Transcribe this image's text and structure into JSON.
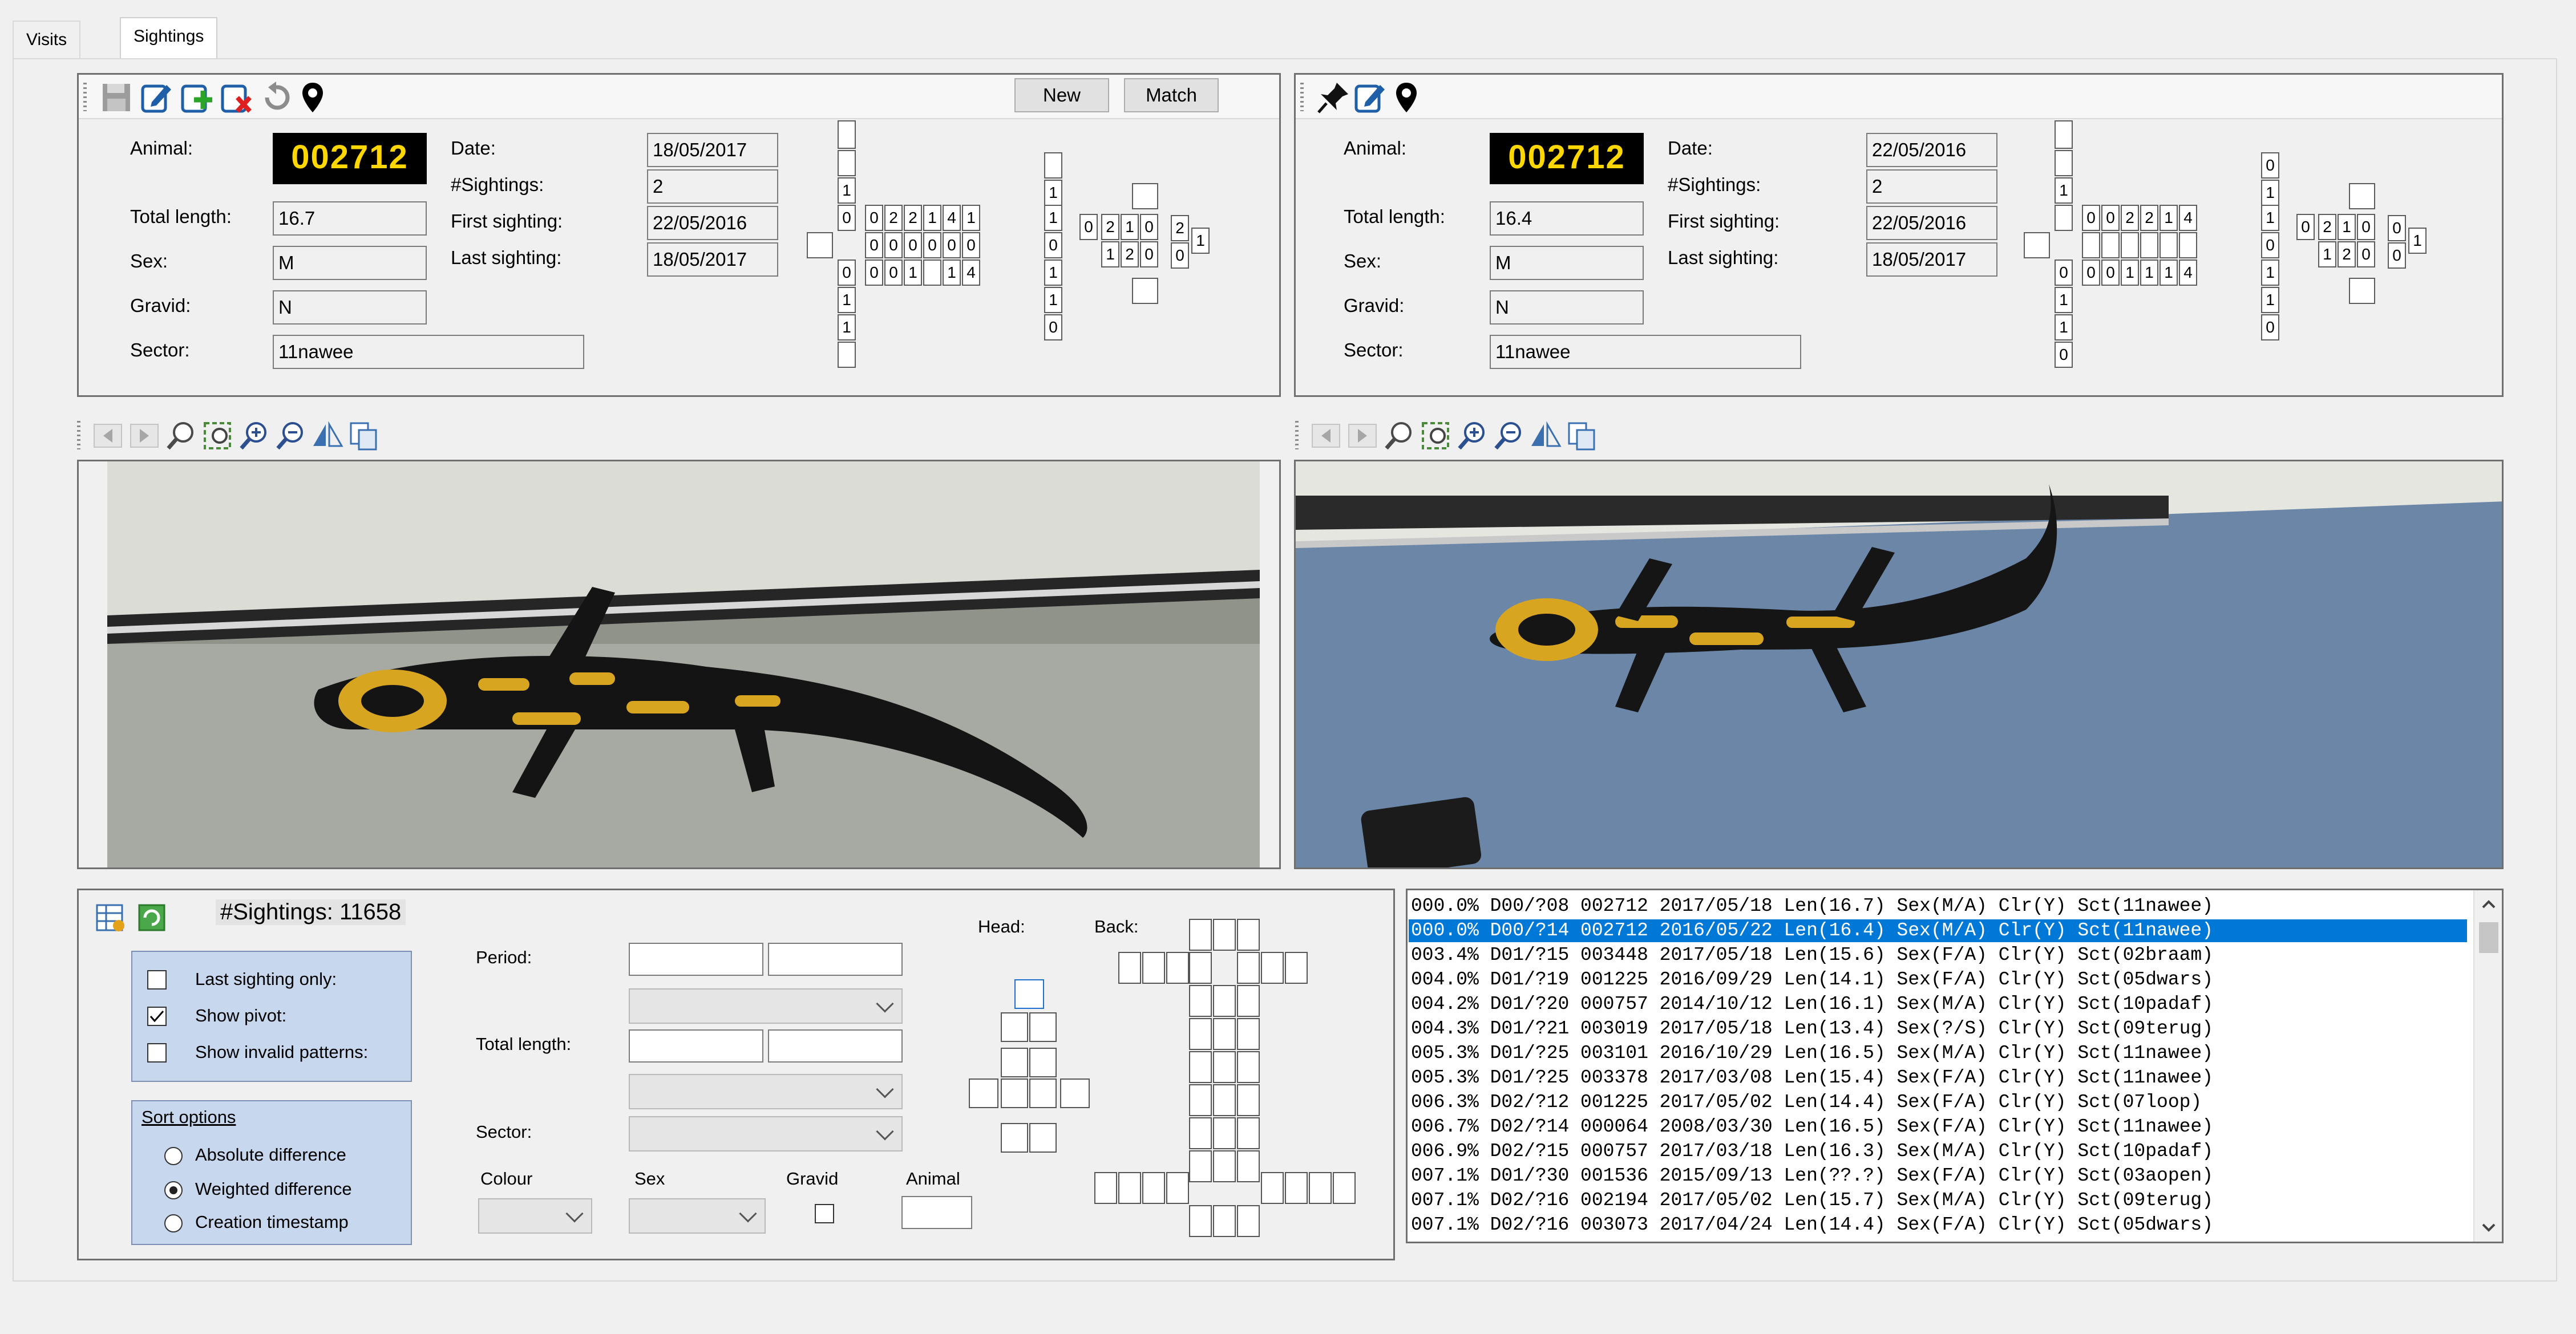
{
  "tabs": [
    {
      "label": "Visits"
    },
    {
      "label": "Sightings"
    }
  ],
  "buttons": {
    "new": "New",
    "match": "Match"
  },
  "labels": {
    "animal": "Animal:",
    "total_length": "Total length:",
    "sex": "Sex:",
    "gravid": "Gravid:",
    "sector": "Sector:",
    "date": "Date:",
    "sightings": "#Sightings:",
    "first_sighting": "First sighting:",
    "last_sighting": "Last sighting:"
  },
  "left_record": {
    "animal_id": "002712",
    "total_length": "16.7",
    "sex": "M",
    "gravid": "N",
    "sector": "11nawee",
    "date": "18/05/2017",
    "sightings": "2",
    "first_sighting": "22/05/2016",
    "last_sighting": "18/05/2017"
  },
  "right_record": {
    "animal_id": "002712",
    "total_length": "16.4",
    "sex": "M",
    "gravid": "N",
    "sector": "11nawee",
    "date": "22/05/2016",
    "sightings": "2",
    "first_sighting": "22/05/2016",
    "last_sighting": "18/05/2017"
  },
  "search": {
    "count_label": "#Sightings: 11658",
    "last_sighting_only": "Last sighting only:",
    "show_pivot": "Show pivot:",
    "show_invalid": "Show invalid patterns:",
    "sort_title": "Sort options",
    "sort_absolute": "Absolute difference",
    "sort_weighted": "Weighted difference",
    "sort_creation": "Creation timestamp",
    "period": "Period:",
    "total_length": "Total length:",
    "sector": "Sector:",
    "colour": "Colour",
    "sex": "Sex",
    "gravid": "Gravid",
    "animal": "Animal",
    "head": "Head:",
    "back": "Back:"
  },
  "matches": [
    "000.0% D00/?08 002712 2017/05/18 Len(16.7) Sex(M/A) Clr(Y) Sct(11nawee)",
    "000.0% D00/?14 002712 2016/05/22 Len(16.4) Sex(M/A) Clr(Y) Sct(11nawee)",
    "003.4% D01/?15 003448 2017/05/18 Len(15.6) Sex(F/A) Clr(Y) Sct(02braam)",
    "004.0% D01/?19 001225 2016/09/29 Len(14.1) Sex(F/A) Clr(Y) Sct(05dwars)",
    "004.2% D01/?20 000757 2014/10/12 Len(16.1) Sex(M/A) Clr(Y) Sct(10padaf)",
    "004.3% D01/?21 003019 2017/05/18 Len(13.4) Sex(?/S) Clr(Y) Sct(09terug)",
    "005.3% D01/?25 003101 2016/10/29 Len(16.5) Sex(M/A) Clr(Y) Sct(11nawee)",
    "005.3% D01/?25 003378 2017/03/08 Len(15.4) Sex(F/A) Clr(Y) Sct(11nawee)",
    "006.3% D02/?12 001225 2017/05/02 Len(14.4) Sex(F/A) Clr(Y) Sct(07loop)",
    "006.7% D02/?14 000064 2008/03/30 Len(16.5) Sex(F/A) Clr(Y) Sct(11nawee)",
    "006.9% D02/?15 000757 2017/03/18 Len(16.3) Sex(M/A) Clr(Y) Sct(10padaf)",
    "007.1% D01/?30 001536 2015/09/13 Len(??.?) Sex(F/A) Clr(Y) Sct(03aopen)",
    "007.1% D02/?16 002194 2017/05/02 Len(15.7) Sex(M/A) Clr(Y) Sct(09terug)",
    "007.1% D02/?16 003073 2017/04/24 Len(14.4) Sex(F/A) Clr(Y) Sct(05dwars)"
  ],
  "selected_match_index": 1,
  "left_pattern": {
    "top": [
      "",
      "1",
      "0"
    ],
    "row1": [
      "0",
      "0",
      "2",
      "2",
      "1",
      "4",
      "1"
    ],
    "row2": [
      "",
      "0",
      "0",
      "0",
      "0",
      "0",
      "0"
    ],
    "row3": [
      "0",
      "0",
      "0",
      "1",
      "",
      "1",
      "4",
      "1"
    ],
    "bottom": [
      "1",
      "1"
    ],
    "tail": [
      "",
      "1",
      "1",
      "",
      "",
      "0"
    ],
    "grid2": [
      "0",
      "2",
      "1",
      "0",
      "1",
      "2",
      "0",
      "1"
    ]
  },
  "right_pattern": {
    "row1": [
      "0",
      "0",
      "2",
      "2",
      "1",
      "4",
      "1"
    ],
    "row3": [
      "0",
      "0",
      "0",
      "1",
      "1",
      "1",
      "4",
      "1"
    ],
    "grid2": [
      "0",
      "2",
      "1",
      "0",
      "1",
      "2",
      "0",
      "1"
    ]
  },
  "colors": {
    "selection": "#0078d7",
    "animal_bg": "#000000",
    "animal_fg": "#ffd700",
    "group_bg": "#c7d7ee"
  }
}
